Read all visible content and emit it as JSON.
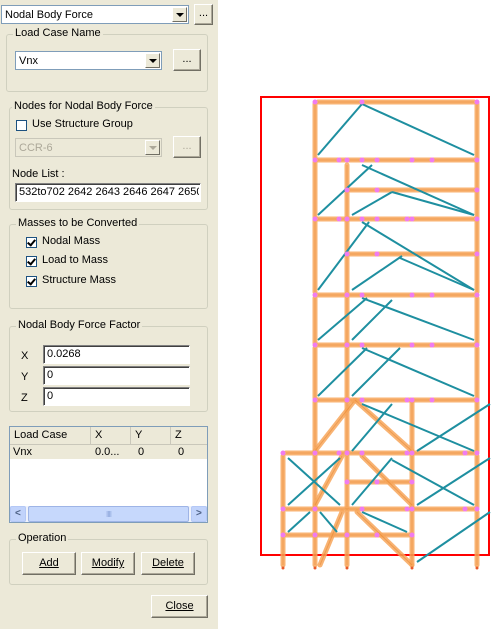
{
  "top": {
    "type_selected": "Nodal Body Force",
    "more_button": "..."
  },
  "load_case": {
    "legend": "Load Case Name",
    "selected": "Vnx",
    "more_button": "..."
  },
  "nodes": {
    "legend": "Nodes for Nodal Body Force",
    "use_structure_group_label": "Use Structure Group",
    "use_structure_group_checked": false,
    "group_selected": "CCR-6",
    "more_button": "...",
    "node_list_label": "Node List :",
    "node_list_value": "532to702 2642 2643 2646 2647 2650"
  },
  "masses": {
    "legend": "Masses to be Converted",
    "items": [
      {
        "label": "Nodal Mass",
        "checked": true
      },
      {
        "label": "Load to Mass",
        "checked": true
      },
      {
        "label": "Structure Mass",
        "checked": true
      }
    ]
  },
  "factor": {
    "legend": "Nodal Body Force Factor",
    "x_label": "X",
    "x_value": "0.0268",
    "y_label": "Y",
    "y_value": "0",
    "z_label": "Z",
    "z_value": "0"
  },
  "table": {
    "columns": [
      "Load Case",
      "X",
      "Y",
      "Z"
    ],
    "rows": [
      [
        "Vnx",
        "0.0...",
        "0",
        "0"
      ]
    ],
    "scroll_left": "<",
    "scroll_right": ">",
    "thumb_grip": "IIII"
  },
  "operation": {
    "legend": "Operation",
    "add": "Add",
    "modify": "Modify",
    "delete": "Delete"
  },
  "close_label": "Close",
  "model_view": {
    "colors": {
      "frame": "#ff0000",
      "member": "#f7a65a",
      "brace": "#1e8fa0",
      "node": "#f07cf0"
    }
  }
}
